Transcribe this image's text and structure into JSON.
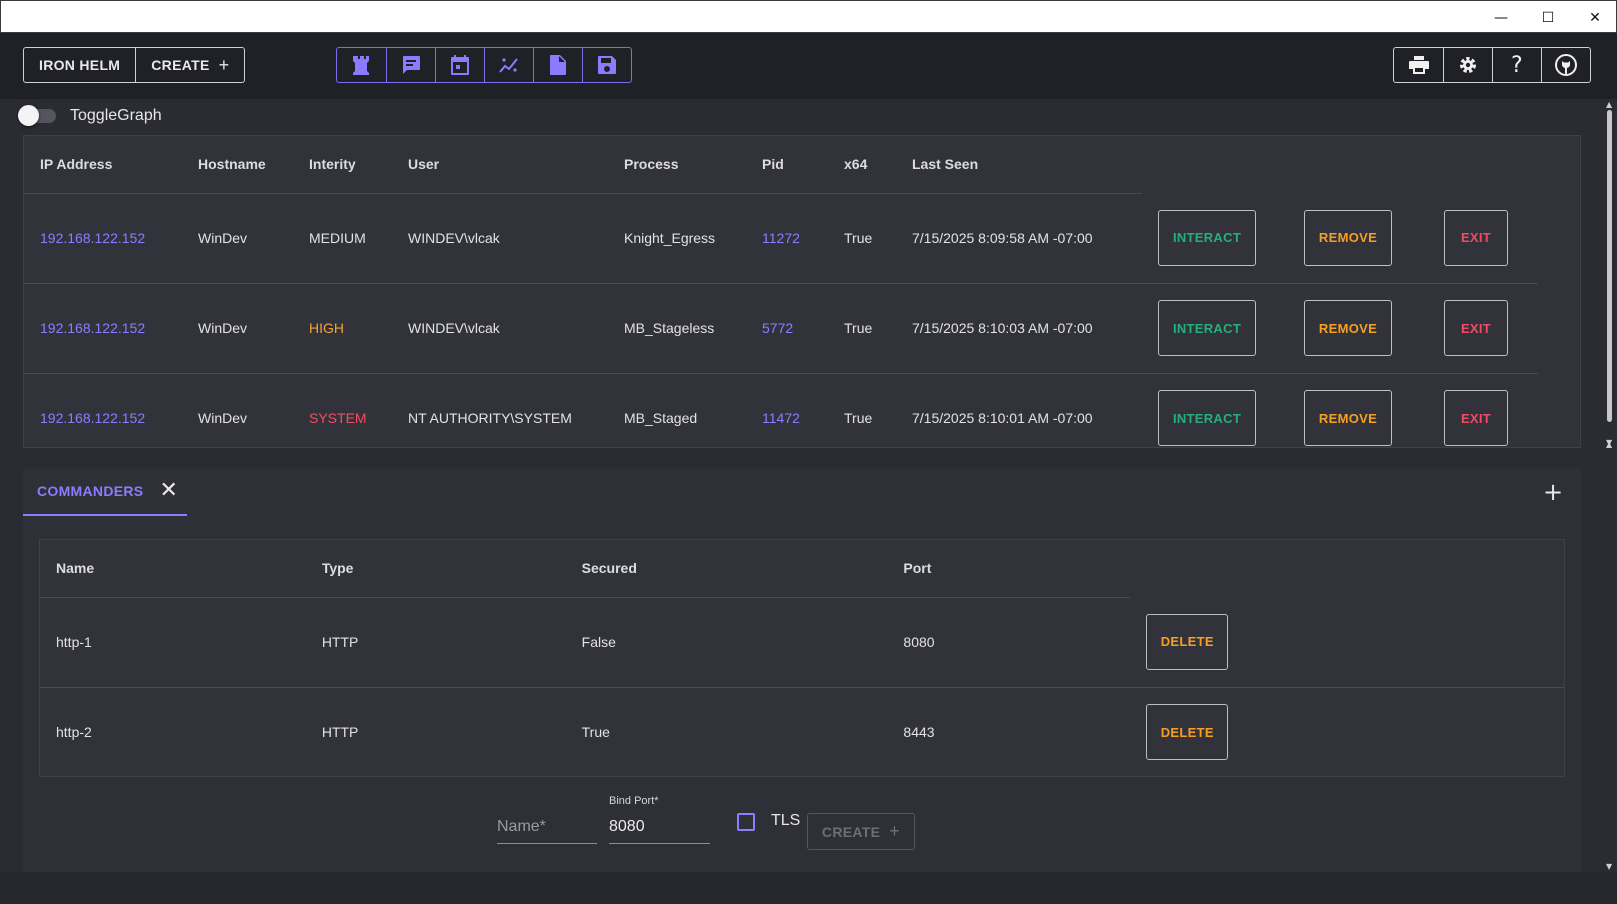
{
  "window": {
    "controls": {
      "minimize": "—",
      "maximize": "☐",
      "close": "✕"
    }
  },
  "toolbar": {
    "iron_helm_label": "IRON HELM",
    "create_label": "CREATE",
    "create_icon": "plus-icon",
    "mid_icons": [
      "tower-icon",
      "chat-icon",
      "calendar-icon",
      "chart-icon",
      "document-icon",
      "save-icon"
    ],
    "right_icons": [
      "printer-icon",
      "gear-icon",
      "help-icon",
      "github-icon"
    ],
    "accent_color": "#8a7dff"
  },
  "toggle": {
    "label": "ToggleGraph",
    "checked": false
  },
  "agents": {
    "columns": [
      "IP Address",
      "Hostname",
      "Interity",
      "User",
      "Process",
      "Pid",
      "x64",
      "Last Seen"
    ],
    "rows": [
      {
        "ip": "192.168.122.152",
        "hostname": "WinDev",
        "integrity": "MEDIUM",
        "user": "WINDEV\\vlcak",
        "process": "Knight_Egress",
        "pid": "11272",
        "x64": "True",
        "last_seen": "7/15/2025 8:09:58 AM -07:00"
      },
      {
        "ip": "192.168.122.152",
        "hostname": "WinDev",
        "integrity": "HIGH",
        "user": "WINDEV\\vlcak",
        "process": "MB_Stageless",
        "pid": "5772",
        "x64": "True",
        "last_seen": "7/15/2025 8:10:03 AM -07:00"
      },
      {
        "ip": "192.168.122.152",
        "hostname": "WinDev",
        "integrity": "SYSTEM",
        "user": "NT AUTHORITY\\SYSTEM",
        "process": "MB_Staged",
        "pid": "11472",
        "x64": "True",
        "last_seen": "7/15/2025 8:10:01 AM -07:00"
      }
    ],
    "actions": {
      "interact": "INTERACT",
      "remove": "REMOVE",
      "exit": "EXIT"
    },
    "colors": {
      "medium": "#e2e2e6",
      "high": "#f0a431",
      "system": "#f44e5e",
      "interact": "#24b07a",
      "remove": "#f5a025",
      "exit": "#ef4c62"
    }
  },
  "tabs": {
    "active_label": "COMMANDERS",
    "close_icon": "close-icon",
    "add_icon": "plus-icon"
  },
  "commanders": {
    "columns": [
      "Name",
      "Type",
      "Secured",
      "Port"
    ],
    "rows": [
      {
        "name": "http-1",
        "type": "HTTP",
        "secured": "False",
        "port": "8080"
      },
      {
        "name": "http-2",
        "type": "HTTP",
        "secured": "True",
        "port": "8443"
      }
    ],
    "delete_label": "DELETE"
  },
  "form": {
    "name_placeholder": "Name*",
    "bind_port_label": "Bind Port*",
    "bind_port_value": "8080",
    "tls_label": "TLS",
    "tls_checked": false,
    "create_label": "CREATE"
  }
}
